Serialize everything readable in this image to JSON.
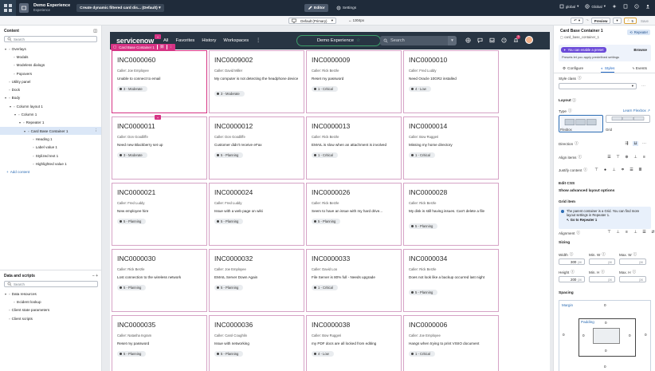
{
  "topbar": {
    "experience_name": "Demo Experience",
    "experience_type": "Experience",
    "page_select": "Create dynamic filtered card dis... (Default)",
    "tabs": [
      {
        "label": "Editor"
      },
      {
        "label": "Settings"
      }
    ],
    "scope": "global",
    "domain": "Global"
  },
  "subbar": {
    "viewport": "Default (Primary)",
    "width_readout": "1304px",
    "preview_label": "Preview",
    "warning_count": "5",
    "save_label": "Save"
  },
  "left_panel": {
    "content_title": "Content",
    "search_placeholder": "Search",
    "tree": [
      {
        "label": "Overlays",
        "level": 0,
        "chev": "▾"
      },
      {
        "label": "Modals",
        "level": 1,
        "chev": ""
      },
      {
        "label": "Modeless dialogs",
        "level": 1,
        "chev": ""
      },
      {
        "label": "Popovers",
        "level": 1,
        "chev": ""
      },
      {
        "label": "Utility panel",
        "level": 0,
        "chev": ""
      },
      {
        "label": "Dock",
        "level": 0,
        "chev": ""
      },
      {
        "label": "Body",
        "level": 0,
        "chev": "▾"
      },
      {
        "label": "Column layout 1",
        "level": 1,
        "chev": "▾"
      },
      {
        "label": "Column 1",
        "level": 2,
        "chev": "▾"
      },
      {
        "label": "Repeater 1",
        "level": 3,
        "chev": "▾"
      },
      {
        "label": "Card Base Container 1",
        "level": 4,
        "chev": "▾",
        "selected": true
      },
      {
        "label": "Heading 1",
        "level": 5,
        "chev": ""
      },
      {
        "label": "Label value 1",
        "level": 5,
        "chev": ""
      },
      {
        "label": "Stylized text 1",
        "level": 5,
        "chev": ""
      },
      {
        "label": "Highlighted value 1",
        "level": 5,
        "chev": ""
      }
    ],
    "add_content": "Add content",
    "data_title": "Data and scripts",
    "data_search_placeholder": "Search",
    "data_tree": [
      {
        "label": "Data resources",
        "level": 0,
        "chev": "▾"
      },
      {
        "label": "Incident lookup",
        "level": 1,
        "chev": ""
      },
      {
        "label": "Client state parameters",
        "level": 0,
        "chev": ""
      },
      {
        "label": "Client scripts",
        "level": 0,
        "chev": ""
      }
    ]
  },
  "canvas": {
    "logo": "servicenow",
    "nav": [
      "All",
      "Favorites",
      "History",
      "Workspaces"
    ],
    "experience_pill": "Demo Experience",
    "search_placeholder": "Search",
    "notif_count": "9",
    "selected_label": "Card Base Container 1",
    "cards": [
      {
        "number": "INC0000060",
        "caller": "Caller: Joe Employee",
        "desc": "Unable to connect to email",
        "priority": "3 - Moderate"
      },
      {
        "number": "INC0009002",
        "caller": "Caller: David Miller",
        "desc": "My computer is not detecting the headphone device",
        "priority": "3 - Moderate"
      },
      {
        "number": "INC0000009",
        "caller": "Caller: Rick Berzle",
        "desc": "Reset my password",
        "priority": "1 - Critical"
      },
      {
        "number": "INC0000010",
        "caller": "Caller: Fred Luddy",
        "desc": "Need Oracle 10GR2 installed",
        "priority": "4 - Low"
      },
      {
        "number": "INC0000011",
        "caller": "Caller: Don Goodliffe",
        "desc": "Need new Blackberry set up",
        "priority": "3 - Moderate"
      },
      {
        "number": "INC0000012",
        "caller": "Caller: Don Goodliffe",
        "desc": "Customer didn't receive eFax",
        "priority": "5 - Planning"
      },
      {
        "number": "INC0000013",
        "caller": "Caller: Rick Berzle",
        "desc": "EMAIL is slow when an attachment is involved",
        "priority": "1 - Critical"
      },
      {
        "number": "INC0000014",
        "caller": "Caller: Bow Ruggeri",
        "desc": "Missing my home directory",
        "priority": "1 - Critical"
      },
      {
        "number": "INC0000021",
        "caller": "Caller: Fred Luddy",
        "desc": "New employee hire",
        "priority": "5 - Planning"
      },
      {
        "number": "INC0000024",
        "caller": "Caller: Fred Luddy",
        "desc": "Issue with a web page on wiki",
        "priority": "5 - Planning"
      },
      {
        "number": "INC0000026",
        "caller": "Caller: Rick Berzle",
        "desc": "Seem to have an issue with my hard drive...",
        "priority": "5 - Planning"
      },
      {
        "number": "INC0000028",
        "caller": "Caller: Rick Berzle",
        "desc": "My disk is still having issues. Can't delete a file",
        "priority": "5 - Planning"
      },
      {
        "number": "INC0000030",
        "caller": "Caller: Rick Berzle",
        "desc": "Lost connection to the wireless network",
        "priority": "5 - Planning"
      },
      {
        "number": "INC0000032",
        "caller": "Caller: Joe Employee",
        "desc": "EMAIL Server Down Again",
        "priority": "5 - Planning"
      },
      {
        "number": "INC0000033",
        "caller": "Caller: David Loo",
        "desc": "File Server is 80% full - Needs upgrade",
        "priority": "1 - Critical"
      },
      {
        "number": "INC0000034",
        "caller": "Caller: Rick Berzle",
        "desc": "Does not look like a backup occurred last night",
        "priority": "5 - Planning"
      },
      {
        "number": "INC0000035",
        "caller": "Caller: Natasha Ingram",
        "desc": "Reset my password",
        "priority": "5 - Planning"
      },
      {
        "number": "INC0000036",
        "caller": "Caller: Carol Coughlin",
        "desc": "Issue with networking",
        "priority": "5 - Planning"
      },
      {
        "number": "INC0000038",
        "caller": "Caller: Bow Ruggeri",
        "desc": "my PDF docs are all locked from editing",
        "priority": "4 - Low"
      },
      {
        "number": "INC0000006",
        "caller": "Caller: Joe Employee",
        "desc": "Hangs when trying to print VISIO document",
        "priority": "1 - Critical"
      }
    ]
  },
  "right_panel": {
    "title": "Card Base Container 1",
    "component_id": "card_base_container_1",
    "parent_badge": "Repeater",
    "preset_pill": "You can enable a preset",
    "browse_label": "Browse",
    "preset_note": "Presets let you apply predefined settings",
    "tabs": [
      "Configure",
      "Styles",
      "Events"
    ],
    "style_class_label": "Style class",
    "layout_label": "Layout",
    "type_label": "Type",
    "learn_flexbox": "Learn Flexbox",
    "type_options": [
      "Flexbox",
      "Grid"
    ],
    "direction_label": "Direction",
    "align_items_label": "Align items",
    "justify_content_label": "Justify content",
    "edit_css_label": "Edit CSS",
    "advanced_label": "Show advanced layout options",
    "grid_item_label": "Grid item",
    "grid_note": "The parent container is a Grid. You can find more layout settings in Repeater 1.",
    "grid_note_link": "Go to Repeater 1",
    "alignment_label": "Alignment",
    "sizing_label": "Sizing",
    "width_label": "Width",
    "min_w_label": "Min. W",
    "max_w_label": "Max. W",
    "height_label": "Height",
    "min_h_label": "Min. H",
    "max_h_label": "Max. H",
    "width_value": "300",
    "height_value": "200",
    "unit": "px",
    "spacing_label": "Spacing",
    "margin_label": "Margin",
    "padding_label": "Padding",
    "margin_values": {
      "top": "0",
      "right": "0",
      "bottom": "0",
      "left": "0"
    },
    "padding_values": {
      "top": "0",
      "right": "0",
      "bottom": "0",
      "left": "0"
    }
  },
  "colors": {
    "selection": "#d63384",
    "topbar": "#1f2b3a",
    "sn_header": "#283543",
    "accent": "#2d6db4"
  },
  "icons": [
    "grid-icon",
    "editor-icon",
    "settings-icon",
    "search-icon",
    "chevron-down-icon",
    "star-icon",
    "globe-icon",
    "chat-icon",
    "help-icon",
    "bell-icon",
    "undo-icon",
    "redo-icon",
    "warning-icon"
  ]
}
